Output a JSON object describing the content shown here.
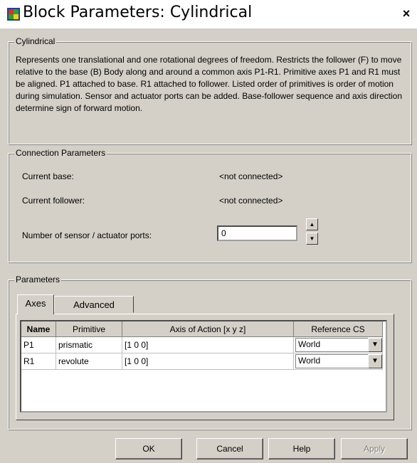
{
  "window": {
    "title": "Block Parameters: Cylindrical",
    "close_glyph": "×",
    "icon": "simulink-block-icon"
  },
  "description": {
    "legend": "Cylindrical",
    "text": "Represents one translational and one rotational degrees of freedom. Restricts the follower (F) to move relative to the base (B) Body along and around a common axis P1-R1. Primitive axes P1 and R1 must be aligned. P1 attached to base. R1 attached to follower. Listed order of primitives is order of motion during simulation. Sensor and actuator ports can be added. Base-follower sequence and axis direction determine sign of forward motion."
  },
  "connection": {
    "legend": "Connection Parameters",
    "base_label": "Current base:",
    "base_value": "<not connected>",
    "follower_label": "Current follower:",
    "follower_value": "<not connected>",
    "ports_label": "Number of sensor / actuator ports:",
    "ports_value": "0"
  },
  "parameters": {
    "legend": "Parameters",
    "tabs": [
      {
        "label": "Axes"
      },
      {
        "label": "Advanced"
      }
    ],
    "columns": {
      "name": "Name",
      "primitive": "Primitive",
      "axis": "Axis of Action [x y z]",
      "ref": "Reference CS"
    },
    "rows": [
      {
        "name": "P1",
        "primitive": "prismatic",
        "axis": "[1 0 0]",
        "ref": "World"
      },
      {
        "name": "R1",
        "primitive": "revolute",
        "axis": "[1 0 0]",
        "ref": "World"
      }
    ]
  },
  "buttons": {
    "ok": "OK",
    "cancel": "Cancel",
    "help": "Help",
    "apply": "Apply"
  },
  "colors": {
    "dialog_bg": "#d4d0c8",
    "title_bg": "#ffffff"
  }
}
